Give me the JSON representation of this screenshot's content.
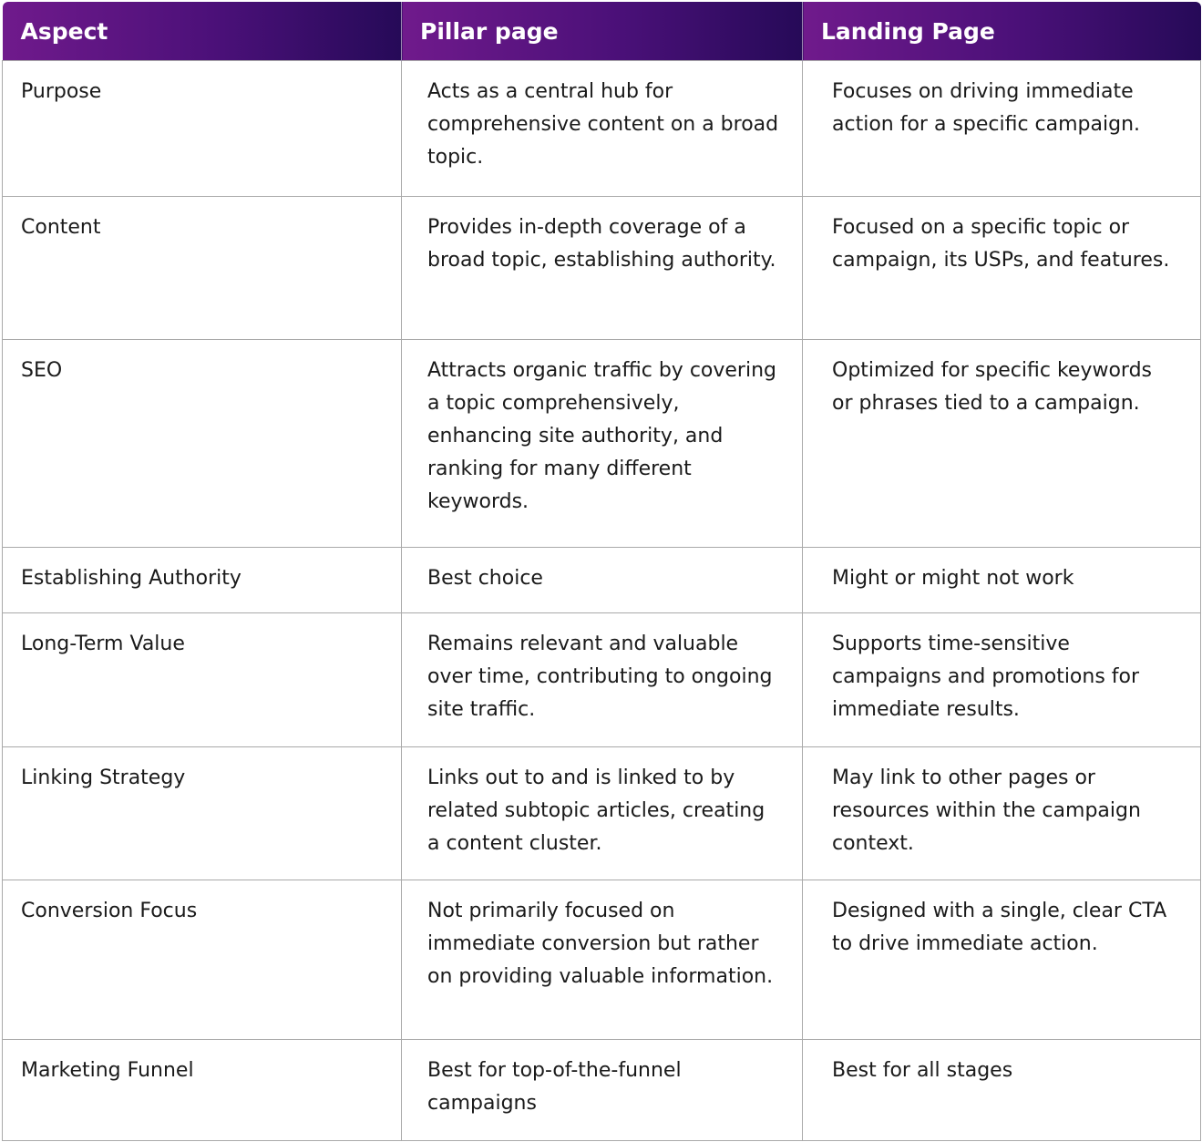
{
  "header": {
    "aspect": "Aspect",
    "pillar": "Pillar page",
    "landing": "Landing Page"
  },
  "colors": {
    "header_gradient_start": "#701a8c",
    "header_gradient_end": "#260a58",
    "border": "#a9a9a9"
  },
  "rows": [
    {
      "aspect": "Purpose",
      "pillar": "Acts as a central hub for comprehensive content on a broad topic.",
      "landing": "Focuses on driving immediate action for a specific campaign."
    },
    {
      "aspect": "Content",
      "pillar": "Provides in-depth coverage of a broad topic, establishing authority.",
      "landing": "Focused on a specific topic or campaign, its USPs, and features."
    },
    {
      "aspect": "SEO",
      "pillar": "Attracts organic traffic by covering a topic comprehensively, enhancing site authority, and ranking for many different keywords.",
      "landing": "Optimized for specific keywords or phrases tied to a campaign."
    },
    {
      "aspect": "Establishing Authority",
      "pillar": "Best choice",
      "landing": "Might or might not work"
    },
    {
      "aspect": "Long-Term Value",
      "pillar": "Remains relevant and valuable over time, contributing to ongoing site traffic.",
      "landing": "Supports time-sensitive campaigns and promotions for immediate results."
    },
    {
      "aspect": "Linking Strategy",
      "pillar": "Links out to and is linked to by related subtopic articles, creating a content cluster.",
      "landing": "May link to other pages or resources within the campaign context."
    },
    {
      "aspect": "Conversion Focus",
      "pillar": "Not primarily focused on immediate conversion but rather on providing valuable information.",
      "landing": "Designed with a single, clear CTA to drive immediate action."
    },
    {
      "aspect": "Marketing Funnel",
      "pillar": "Best for top-of-the-funnel campaigns",
      "landing": "Best for all stages"
    }
  ]
}
